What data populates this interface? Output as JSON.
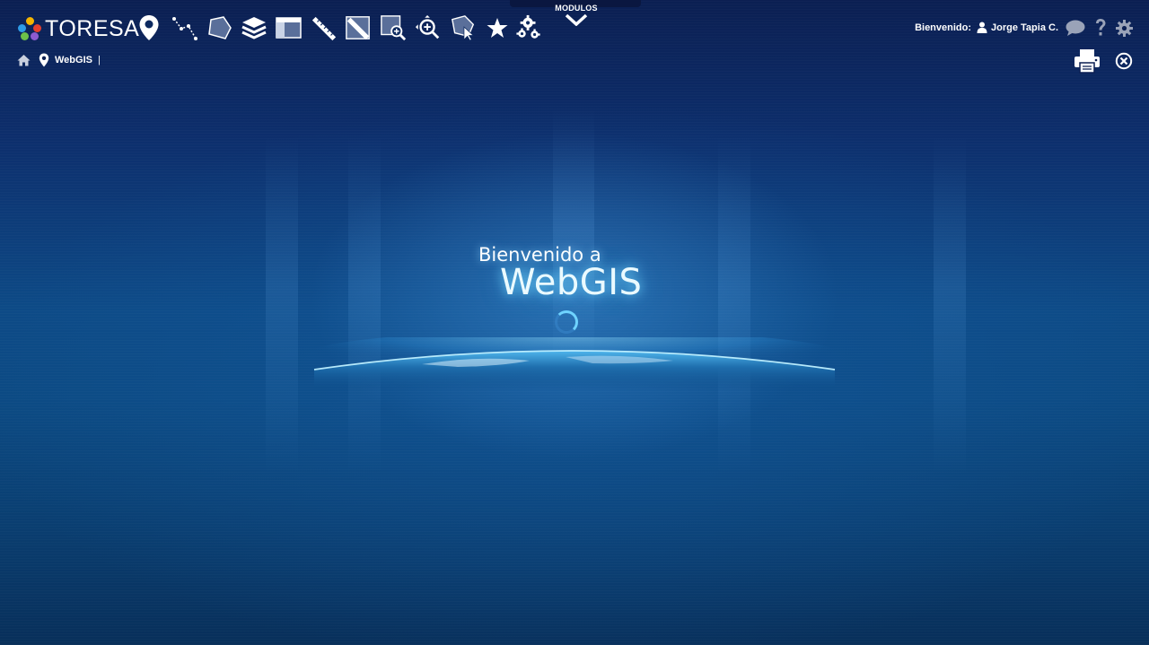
{
  "header": {
    "brand": "TORESA",
    "brand_colors": [
      "#f5b400",
      "#e5402d",
      "#2e9be6",
      "#6cc04a",
      "#8c5bd0"
    ],
    "modules_label": "MODULOS",
    "welcome_label": "Bienvenido:",
    "user_name": "Jorge Tapia C."
  },
  "toolbar": {
    "icons": [
      "map-marker-icon",
      "polyline-icon",
      "polygon-icon",
      "layers-icon",
      "panel-icon",
      "ruler-icon",
      "area-ruler-icon",
      "zoom-box-icon",
      "pan-zoom-icon",
      "select-polygon-icon",
      "star-icon",
      "settings-gears-icon"
    ]
  },
  "breadcrumb": {
    "current": "WebGIS",
    "separator": "|"
  },
  "hero": {
    "welcome": "Bienvenido a",
    "title": "WebGIS"
  },
  "colors": {
    "background_top": "#0b1f52",
    "background_mid": "#0d4a86",
    "glow": "#6fd3ff"
  }
}
